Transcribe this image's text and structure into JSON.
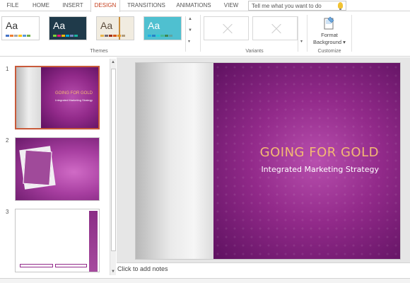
{
  "ribbon_tabs": [
    "FILE",
    "HOME",
    "INSERT",
    "DESIGN",
    "TRANSITIONS",
    "ANIMATIONS",
    "VIEW"
  ],
  "active_tab": "DESIGN",
  "tell_me": {
    "placeholder": "Tell me what you want to do"
  },
  "themes": {
    "label": "Themes",
    "items": [
      {
        "glyph": "Aa",
        "swatches": [
          "#4472c4",
          "#ed7d31",
          "#a5a5a5",
          "#ffc000",
          "#5b9bd5",
          "#70ad47"
        ]
      },
      {
        "glyph": "Aa",
        "swatches": [
          "#7fd13b",
          "#ea157a",
          "#feb80a",
          "#00addc",
          "#738ac8",
          "#1ab39f"
        ]
      },
      {
        "glyph": "Aa",
        "swatches": [
          "#e8b54d",
          "#786c71",
          "#a5300f",
          "#d55816",
          "#e19825",
          "#b19c7d"
        ]
      },
      {
        "glyph": "Aa",
        "swatches": [
          "#1cade4",
          "#2683c6",
          "#27ced7",
          "#42ba97",
          "#3e8853",
          "#62a39f"
        ]
      }
    ]
  },
  "variants": {
    "label": "Variants"
  },
  "customize": {
    "label": "Customize",
    "format_background": "Format Background ▾"
  },
  "slides": [
    {
      "number": "1",
      "title": "GOING FOR GOLD",
      "subtitle": "Integrated Marketing Strategy",
      "selected": true
    },
    {
      "number": "2"
    },
    {
      "number": "3"
    }
  ],
  "main_slide": {
    "title": "GOING FOR GOLD",
    "subtitle": "Integrated Marketing Strategy"
  },
  "notes": {
    "placeholder": "Click to add notes"
  },
  "colors": {
    "accent": "#c43e1c",
    "slide_purple": "#922a8a",
    "title_gold": "#f4b973"
  }
}
